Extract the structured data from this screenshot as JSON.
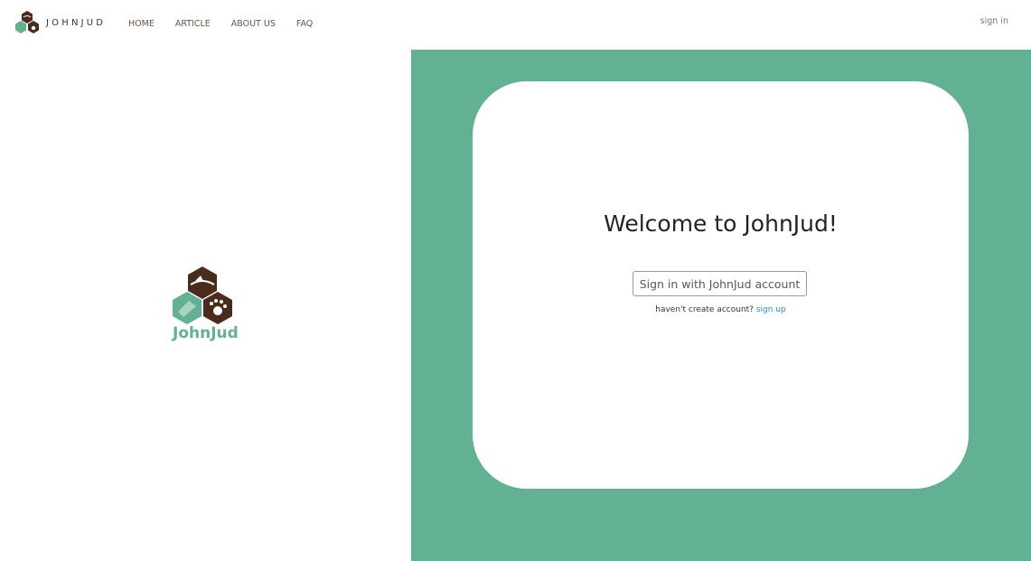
{
  "nav": {
    "brand": "JOHNJUD",
    "links": [
      "HOME",
      "ARTICLE",
      "ABOUT US",
      "FAQ"
    ],
    "signin": "sign in"
  },
  "hero": {
    "logo_text": "JohnJud"
  },
  "card": {
    "title": "Welcome to JohnJud!",
    "account_button": "Sign in with JohnJud account",
    "signup_prompt": "haven't create account?",
    "signup_link": "sign up"
  },
  "colors": {
    "accent_green": "#61b192",
    "brand_brown": "#4a2c1d",
    "link_blue": "#2a8bd6"
  },
  "icons": [
    "johnjud-logo-icon"
  ]
}
